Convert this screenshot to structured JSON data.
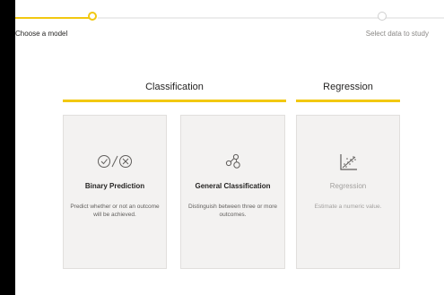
{
  "stepper": {
    "steps": [
      {
        "label": "Choose a model",
        "state": "active"
      },
      {
        "label": "Select data to study",
        "state": "inactive"
      }
    ]
  },
  "sections": [
    {
      "title": "Classification"
    },
    {
      "title": "Regression"
    }
  ],
  "cards": [
    {
      "icon": "binary-check-cross-icon",
      "title": "Binary Prediction",
      "description": "Predict whether or not an outcome will be achieved.",
      "enabled": true
    },
    {
      "icon": "node-cluster-icon",
      "title": "General Classification",
      "description": "Distinguish between three or more outcomes.",
      "enabled": true
    },
    {
      "icon": "scatter-trend-icon",
      "title": "Regression",
      "description": "Estimate a numeric value.",
      "enabled": false
    }
  ],
  "colors": {
    "accent": "#f2c811",
    "card_bg": "#f3f2f1",
    "card_border": "#e1dfdd",
    "text": "#252423",
    "muted": "#8a8886"
  }
}
